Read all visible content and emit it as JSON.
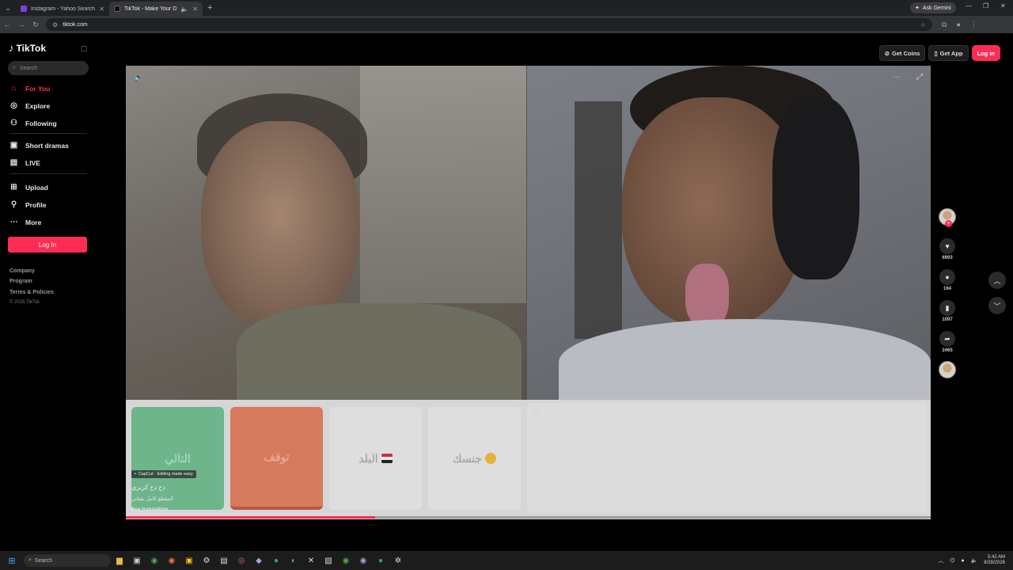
{
  "browser": {
    "tabs": [
      {
        "title": "Instagram - Yahoo Search Resu",
        "active": false,
        "favicon_color": "#7b3fe4"
      },
      {
        "title": "TikTok - Make Your Day",
        "active": true,
        "favicon_color": "#111111"
      }
    ],
    "gemini_label": "Ask Gemini",
    "url": "tiktok.com"
  },
  "tiktok": {
    "logo": "TikTok",
    "search_placeholder": "Search",
    "nav": [
      {
        "label": "For You",
        "icon": "home-icon",
        "active": true
      },
      {
        "label": "Explore",
        "icon": "compass-icon",
        "active": false
      },
      {
        "label": "Following",
        "icon": "following-icon",
        "active": false
      },
      {
        "label": "Short dramas",
        "icon": "short-dramas-icon",
        "active": false
      },
      {
        "label": "LIVE",
        "icon": "live-icon",
        "active": false
      },
      {
        "label": "Upload",
        "icon": "upload-icon",
        "active": false
      },
      {
        "label": "Profile",
        "icon": "profile-icon",
        "active": false
      },
      {
        "label": "More",
        "icon": "more-icon",
        "active": false
      }
    ],
    "login_label": "Log In",
    "footer": [
      "Company",
      "Program",
      "Terms & Policies"
    ],
    "copyright": "© 2026 TikTok",
    "top_actions": {
      "coins": "Get Coins",
      "app": "Get App",
      "login": "Log in"
    }
  },
  "video": {
    "cards": [
      "التالي",
      "توقف",
      "البلد",
      "جنسك"
    ],
    "capcut_label": "CapCut · Editing made easy",
    "caption_title": "دح دح كريزي",
    "caption_desc": "المقطع كامل بقناتي",
    "see_translation": "See translation",
    "progress": 0.31
  },
  "actions": {
    "likes": "6993",
    "comments": "164",
    "saves": "1097",
    "shares": "2465"
  },
  "taskbar": {
    "search_placeholder": "Search",
    "time": "5:42 AM",
    "date": "8/28/2026"
  },
  "colors": {
    "accent": "#fe2c55"
  }
}
